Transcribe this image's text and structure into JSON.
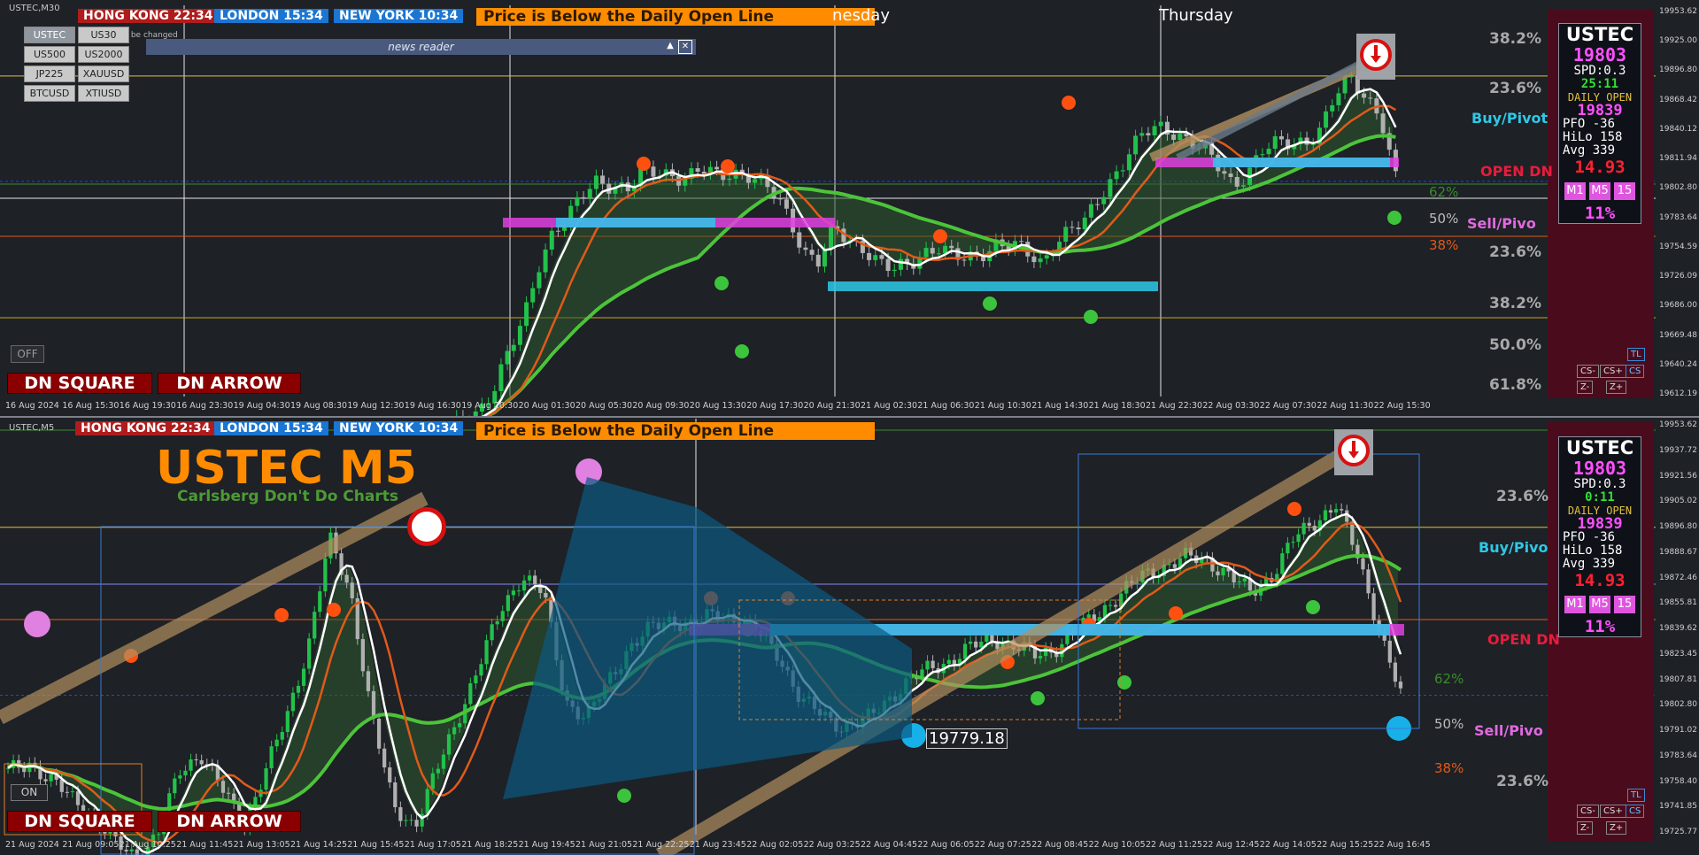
{
  "colors": {
    "bg": "#1e2126",
    "bull": "#21c24a",
    "bear": "#b0b0b0",
    "ma_fast": "#ffffff",
    "ma_mid": "#e05a1a",
    "ma_slow": "#4cc43a",
    "zone": "#4a0c1c",
    "pivot_buy": "#2ec8e8",
    "pivot_open": "#e81c3c",
    "pivot_sell": "#e06ae0",
    "daily_open": "#e0c040"
  },
  "top": {
    "chart_id": "USTEC,M30",
    "sessions": [
      {
        "label": "HONG KONG 22:34",
        "color": "#b01c1c"
      },
      {
        "label": "LONDON   15:34",
        "color": "#1a76d2"
      },
      {
        "label": "NEW YORK 10:34",
        "color": "#1a76d2"
      }
    ],
    "banner": "Price is Below the Daily Open Line",
    "day_labels": [
      "nesday",
      "Thursday"
    ],
    "symbols": [
      "USTEC",
      "US30",
      "US500",
      "US2000",
      "JP225",
      "XAUUSD",
      "BTCUSD",
      "XTIUSD"
    ],
    "indicator_warning": "cator cannot be changed",
    "news_title": "news reader",
    "off_label": "OFF",
    "dn_square": "DN SQUARE",
    "dn_arrow": "DN ARROW",
    "fib_labels": [
      "38.2%",
      "23.6%",
      "23.6%",
      "38.2%",
      "50.0%",
      "61.8%"
    ],
    "pct_labels": [
      "62%",
      "50%",
      "38%"
    ],
    "pivot_labels": {
      "buy": "Buy/Pivot",
      "open": "OPEN DN",
      "sell": "Sell/Pivo"
    },
    "info": {
      "title": "USTEC",
      "price": "19803",
      "spd": "SPD:0.3",
      "timer": "25:11",
      "do_label": "DAILY OPEN",
      "do_value": "19839",
      "pfo": "PFO  -36",
      "hilo": "HiLo 158",
      "avg": "Avg  339",
      "atr": "14.93",
      "tfs": [
        "M1",
        "M5",
        "15"
      ],
      "pct": "11%"
    },
    "y_ticks": [
      "19953.62",
      "19925.00",
      "19896.80",
      "19868.42",
      "19840.12",
      "19811.94",
      "19802.80",
      "19783.64",
      "19754.59",
      "19726.09",
      "19686.00",
      "19669.48",
      "19640.24",
      "19612.19"
    ],
    "x_ticks": [
      "16 Aug 2024",
      "16 Aug 15:30",
      "16 Aug 19:30",
      "16 Aug 23:30",
      "19 Aug 04:30",
      "19 Aug 08:30",
      "19 Aug 12:30",
      "19 Aug 16:30",
      "19 Aug 20:30",
      "20 Aug 01:30",
      "20 Aug 05:30",
      "20 Aug 09:30",
      "20 Aug 13:30",
      "20 Aug 17:30",
      "20 Aug 21:30",
      "21 Aug 02:30",
      "21 Aug 06:30",
      "21 Aug 10:30",
      "21 Aug 14:30",
      "21 Aug 18:30",
      "21 Aug 22:30",
      "22 Aug 03:30",
      "22 Aug 07:30",
      "22 Aug 11:30",
      "22 Aug 15:30"
    ],
    "side_buttons": [
      "TL",
      "CS-",
      "CS+",
      "CS",
      "Z-",
      "Z+"
    ]
  },
  "bottom": {
    "chart_id": "USTEC,M5",
    "sessions": [
      {
        "label": "HONG KONG 22:34",
        "color": "#b01c1c"
      },
      {
        "label": "LONDON   15:34",
        "color": "#1a76d2"
      },
      {
        "label": "NEW YORK 10:34",
        "color": "#1a76d2"
      }
    ],
    "banner": "Price is Below the Daily Open Line",
    "big_title": "USTEC M5",
    "sub_title": "Carlsberg Don't Do Charts",
    "on_label": "ON",
    "dn_square": "DN SQUARE",
    "dn_arrow": "DN ARROW",
    "fib_labels": [
      "23.6%",
      "23.6%"
    ],
    "pct_labels": [
      "62%",
      "50%",
      "38%"
    ],
    "price_tag": "19779.18",
    "pivot_labels": {
      "buy": "Buy/Pivo",
      "open": "OPEN DN",
      "sell": "Sell/Pivo"
    },
    "info": {
      "title": "USTEC",
      "price": "19803",
      "spd": "SPD:0.3",
      "timer": "0:11",
      "do_label": "DAILY OPEN",
      "do_value": "19839",
      "pfo": "PFO  -36",
      "hilo": "HiLo 158",
      "avg": "Avg  339",
      "atr": "14.93",
      "tfs": [
        "M1",
        "M5",
        "15"
      ],
      "pct": "11%"
    },
    "y_ticks": [
      "19953.62",
      "19937.72",
      "19921.56",
      "19905.02",
      "19896.80",
      "19888.67",
      "19872.46",
      "19855.81",
      "19839.62",
      "19823.45",
      "19807.81",
      "19802.80",
      "19791.02",
      "19783.64",
      "19758.40",
      "19741.85",
      "19725.77"
    ],
    "x_ticks": [
      "21 Aug 2024",
      "21 Aug 09:05",
      "21 Aug 10:25",
      "21 Aug 11:45",
      "21 Aug 13:05",
      "21 Aug 14:25",
      "21 Aug 15:45",
      "21 Aug 17:05",
      "21 Aug 18:25",
      "21 Aug 19:45",
      "21 Aug 21:05",
      "21 Aug 22:25",
      "21 Aug 23:45",
      "22 Aug 02:05",
      "22 Aug 03:25",
      "22 Aug 04:45",
      "22 Aug 06:05",
      "22 Aug 07:25",
      "22 Aug 08:45",
      "22 Aug 10:05",
      "22 Aug 11:25",
      "22 Aug 12:45",
      "22 Aug 14:05",
      "22 Aug 15:25",
      "22 Aug 16:45"
    ],
    "side_buttons": [
      "TL",
      "CS-",
      "CS+",
      "CS",
      "Z-",
      "Z+"
    ]
  },
  "chart_data": [
    {
      "type": "candlestick",
      "title": "USTEC,M30",
      "ylim": [
        19612.19,
        19953.62
      ],
      "daily_open": 19896.8,
      "current_price": 19802.8,
      "close_path": [
        19580,
        19590,
        19600,
        19620,
        19650,
        19680,
        19730,
        19760,
        19770,
        19790,
        19805,
        19800,
        19795,
        19808,
        19812,
        19810,
        19805,
        19812,
        19808,
        19812,
        19810,
        19800,
        19790,
        19770,
        19740,
        19730,
        19760,
        19750,
        19745,
        19730,
        19722,
        19728,
        19740,
        19745,
        19735,
        19732,
        19740,
        19748,
        19745,
        19738,
        19730,
        19750,
        19760,
        19765,
        19790,
        19810,
        19830,
        19845,
        19850,
        19848,
        19840,
        19830,
        19815,
        19800,
        19812,
        19830,
        19835,
        19838,
        19840,
        19850,
        19880,
        19895,
        19880,
        19860,
        19803
      ]
    },
    {
      "type": "candlestick",
      "title": "USTEC,M5",
      "ylim": [
        19725.77,
        19953.62
      ],
      "daily_open": 19896.8,
      "current_price": 19802.8,
      "marked_low": 19779.18,
      "close_path": [
        19760,
        19765,
        19755,
        19745,
        19735,
        19720,
        19712,
        19725,
        19760,
        19770,
        19750,
        19730,
        19760,
        19790,
        19830,
        19890,
        19860,
        19790,
        19740,
        19730,
        19760,
        19790,
        19820,
        19850,
        19870,
        19860,
        19800,
        19790,
        19810,
        19830,
        19840,
        19845,
        19842,
        19848,
        19846,
        19838,
        19825,
        19800,
        19792,
        19785,
        19788,
        19800,
        19810,
        19818,
        19822,
        19830,
        19835,
        19830,
        19825,
        19830,
        19840,
        19850,
        19860,
        19870,
        19875,
        19880,
        19878,
        19870,
        19860,
        19870,
        19890,
        19900,
        19910,
        19880,
        19840,
        19803
      ]
    }
  ]
}
